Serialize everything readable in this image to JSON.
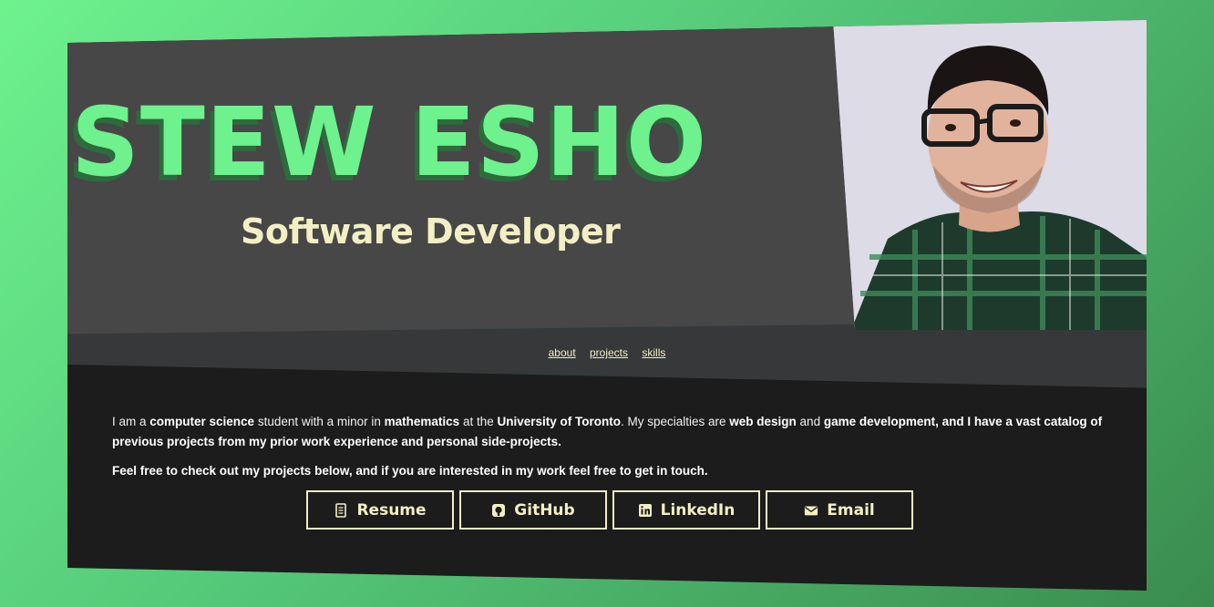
{
  "hero": {
    "name": "STEW ESHO",
    "role": "Software Developer"
  },
  "nav": {
    "items": [
      "about",
      "projects",
      "skills"
    ]
  },
  "about": {
    "p1": {
      "t1": "I am a ",
      "b1": "computer science",
      "t2": " student with a minor in ",
      "b2": "mathematics",
      "t3": " at the ",
      "b3": "University of Toronto",
      "t4": ". My specialties are ",
      "b4": "web design",
      "t5": " and ",
      "b5": "game development, and I have a vast catalog of previous projects from my prior work experience and personal side-projects."
    },
    "p2": "Feel free to check out my projects below, and if you are interested in my work feel free to get in touch."
  },
  "buttons": [
    {
      "label": "Resume",
      "icon": "document-icon"
    },
    {
      "label": "GitHub",
      "icon": "github-icon"
    },
    {
      "label": "LinkedIn",
      "icon": "linkedin-icon"
    },
    {
      "label": "Email",
      "icon": "envelope-icon"
    }
  ],
  "colors": {
    "accent": "#6ef28e",
    "cream": "#f3efc4",
    "hero_bg": "#474747",
    "body_bg": "#1c1c1c"
  }
}
